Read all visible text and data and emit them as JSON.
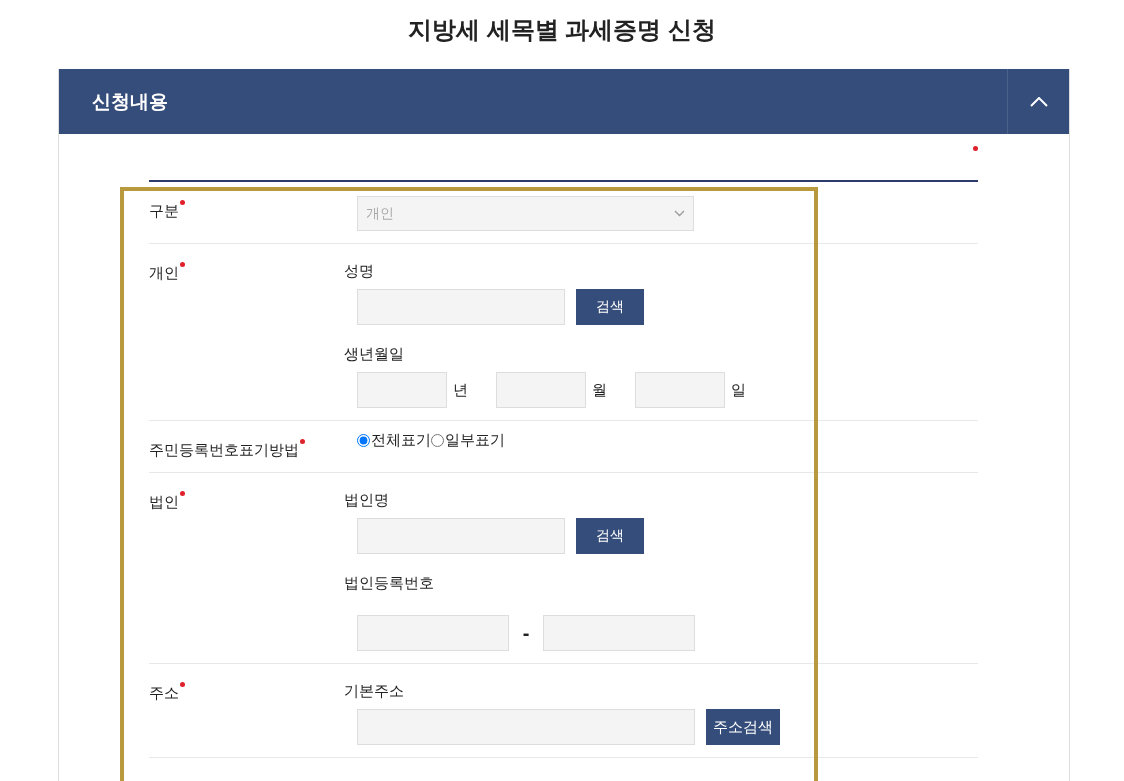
{
  "page_title": "지방세 세목별 과세증명 신청",
  "panel": {
    "title": "신청내용",
    "expanded": true,
    "required_legend": true
  },
  "highlight": true,
  "rows": [
    {
      "label": "구분",
      "required": true,
      "blocks": [
        {
          "kind": "select",
          "value": "개인",
          "disabled": true
        }
      ]
    },
    {
      "label": "개인",
      "required": true,
      "blocks": [
        {
          "kind": "heading",
          "text": "성명"
        },
        {
          "kind": "search",
          "button": "검색"
        },
        {
          "kind": "heading",
          "text": "생년월일"
        },
        {
          "kind": "date",
          "units": [
            "년",
            "월",
            "일"
          ]
        }
      ]
    },
    {
      "label": "주민등록번호표기방법",
      "required": true,
      "blocks": [
        {
          "kind": "radios",
          "options": [
            {
              "label": "전체표기",
              "selected": true
            },
            {
              "label": "일부표기",
              "selected": false
            }
          ]
        }
      ]
    },
    {
      "label": "법인",
      "required": true,
      "blocks": [
        {
          "kind": "heading",
          "text": "법인명"
        },
        {
          "kind": "search",
          "button": "검색"
        },
        {
          "kind": "heading",
          "text": "법인등록번호"
        },
        {
          "kind": "split",
          "separator": "-"
        }
      ]
    },
    {
      "label": "주소",
      "required": true,
      "blocks": [
        {
          "kind": "heading",
          "text": "기본주소"
        },
        {
          "kind": "address",
          "button": "주소검색"
        }
      ]
    }
  ]
}
